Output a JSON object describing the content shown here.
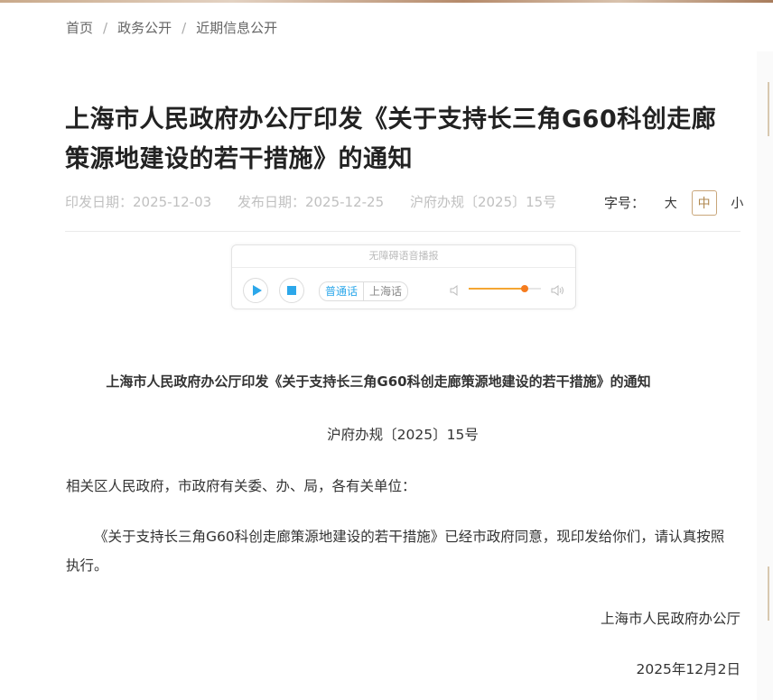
{
  "breadcrumb": {
    "items": [
      "首页",
      "政务公开",
      "近期信息公开"
    ],
    "separator": "/"
  },
  "title": "上海市人民政府办公厅印发《关于支持长三角G60科创走廊策源地建设的若干措施》的通知",
  "meta": {
    "issue_date": "印发日期：2025-12-03",
    "publish_date": "发布日期：2025-12-25",
    "doc_no": "沪府办规〔2025〕15号"
  },
  "font_size": {
    "label": "字号：",
    "large": "大",
    "medium": "中",
    "small": "小",
    "selected": "中"
  },
  "player": {
    "title": "无障碍语音播报",
    "dialects": [
      "普通话",
      "上海话"
    ],
    "selected_dialect": "普通话",
    "play_icon": "play-icon",
    "stop_icon": "stop-icon",
    "volume_level": 0.78,
    "colors": {
      "accent": "#2ca7ea",
      "volume": "#f57c1f"
    }
  },
  "document": {
    "heading": "上海市人民政府办公厅印发《关于支持长三角G60科创走廊策源地建设的若干措施》的通知",
    "number": "沪府办规〔2025〕15号",
    "salutation": "相关区人民政府，市政府有关委、办、局，各有关单位：",
    "body": "《关于支持长三角G60科创走廊策源地建设的若干措施》已经市政府同意，现印发给你们，请认真按照执行。",
    "signature_org": "上海市人民政府办公厅",
    "signature_date": "2025年12月2日"
  }
}
